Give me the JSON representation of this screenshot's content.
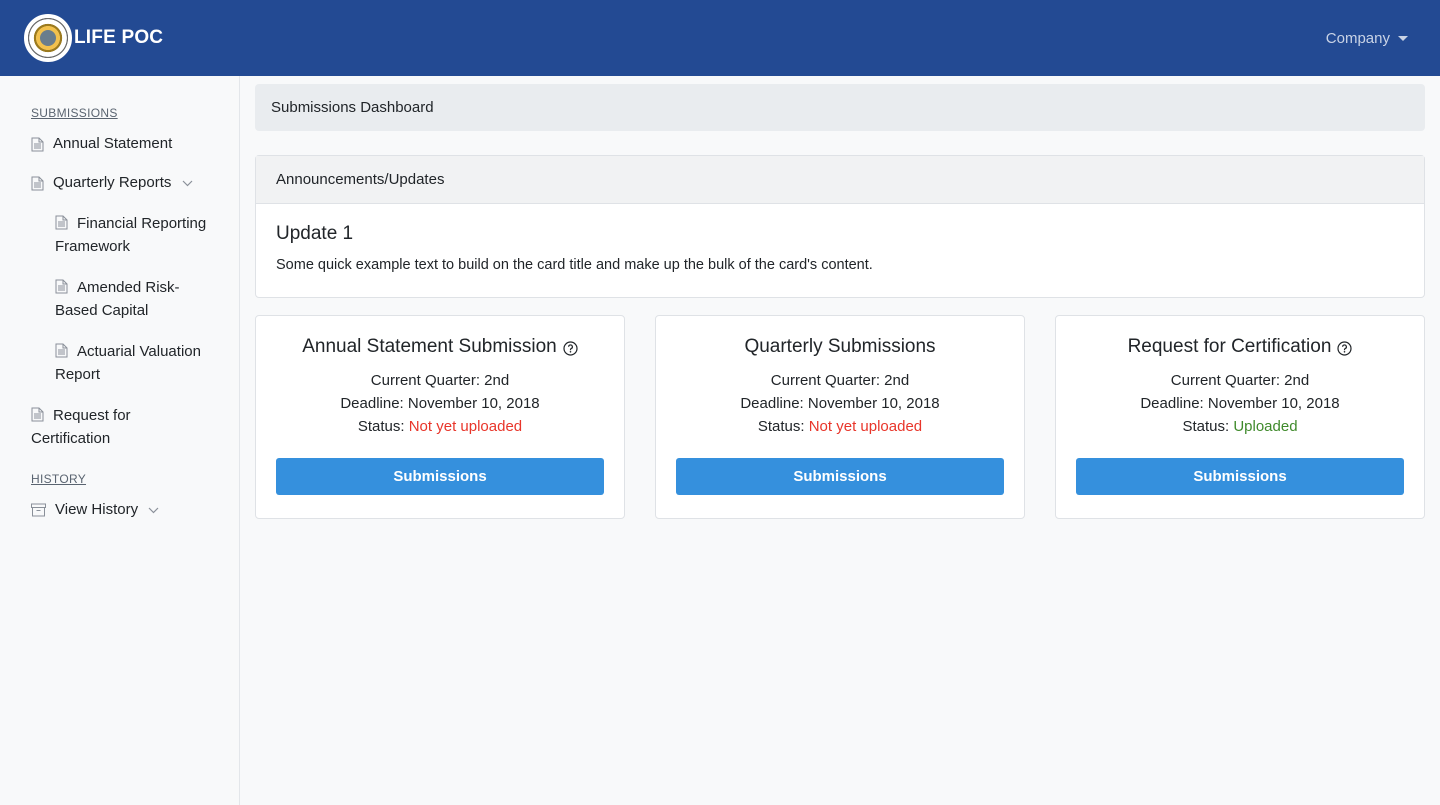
{
  "app": {
    "brand_name": "LIFE POC"
  },
  "navbar": {
    "company_label": "Company"
  },
  "sidebar": {
    "submissions_title": "SUBMISSIONS",
    "items": [
      {
        "label": "Annual Statement"
      },
      {
        "label": "Quarterly Reports"
      },
      {
        "label": "Financial Reporting Framework"
      },
      {
        "label": "Amended Risk-Based Capital"
      },
      {
        "label": "Actuarial Valuation Report"
      },
      {
        "label": "Request for Certification"
      }
    ],
    "history_title": "HISTORY",
    "history_item": "View History"
  },
  "breadcrumb": {
    "title": "Submissions Dashboard"
  },
  "announcements": {
    "header": "Announcements/Updates",
    "title": "Update 1",
    "text": "Some quick example text to build on the card title and make up the bulk of the card's content."
  },
  "cards": [
    {
      "title": "Annual Statement Submission",
      "quarter": "Current Quarter: 2nd",
      "deadline": "Deadline: November 10, 2018",
      "status_prefix": "Status:",
      "status": "Not yet uploaded",
      "button": "Submissions"
    },
    {
      "title": "Quarterly Submissions",
      "quarter": "Current Quarter: 2nd",
      "deadline": "Deadline: November 10, 2018",
      "status_prefix": "Status:",
      "status": "Not yet uploaded",
      "button": "Submissions"
    },
    {
      "title": "Request for Certification",
      "quarter": "Current Quarter: 2nd",
      "deadline": "Deadline: November 10, 2018",
      "status_prefix": "Status:",
      "status": "Uploaded",
      "button": "Submissions"
    }
  ],
  "colors": {
    "navbar": "#234a93",
    "button": "#3590dd",
    "status_bad": "#e8352a",
    "status_ok": "#3f8a2b"
  }
}
